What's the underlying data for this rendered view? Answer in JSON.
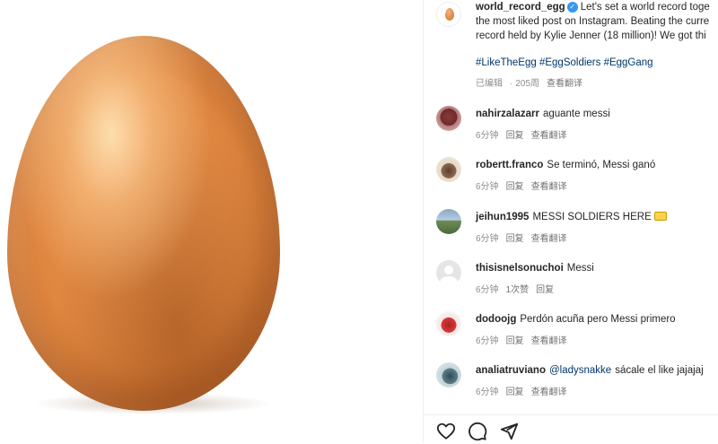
{
  "post": {
    "username": "world_record_egg",
    "caption_lines": [
      "Let's set a world record toge",
      "the most liked post on Instagram. Beating the curre",
      "record held by Kylie Jenner (18 million)! We got thi"
    ],
    "hashtags": "#LikeTheEgg #EggSoldiers #EggGang",
    "edited_label": "已编辑",
    "age": "205周",
    "see_translation": "查看翻译"
  },
  "comments": [
    {
      "username": "nahirzalazarr",
      "text": "aguante messi",
      "time": "6分钟",
      "reply": "回复",
      "translate": "查看翻译"
    },
    {
      "username": "robertt.franco",
      "text": "Se terminó, Messi ganó",
      "time": "6分钟",
      "reply": "回复",
      "translate": "查看翻译"
    },
    {
      "username": "jeihun1995",
      "text": "MESSI SOLDIERS HERE",
      "time": "6分钟",
      "reply": "回复",
      "translate": "查看翻译"
    },
    {
      "username": "thisisnelsonuchoi",
      "text": "Messi",
      "time": "6分钟",
      "likes": "1次赞",
      "reply": "回复"
    },
    {
      "username": "dodoojg",
      "text": "Perdón acuña pero Messi primero",
      "time": "6分钟",
      "reply": "回复",
      "translate": "查看翻译"
    },
    {
      "username": "analiatruviano",
      "mention": "@ladysnakke",
      "text": "sácale el like jajajaj",
      "time": "6分钟",
      "reply": "回复",
      "translate": "查看翻译"
    }
  ],
  "icons": {
    "like": "heart-icon",
    "comment": "comment-bubble-icon",
    "share": "send-paper-plane-icon",
    "verified": "verified-badge-icon"
  },
  "colors": {
    "link": "#00376b",
    "verified": "#3897f0",
    "muted": "#8e8e8e",
    "egg": "#df8640"
  }
}
